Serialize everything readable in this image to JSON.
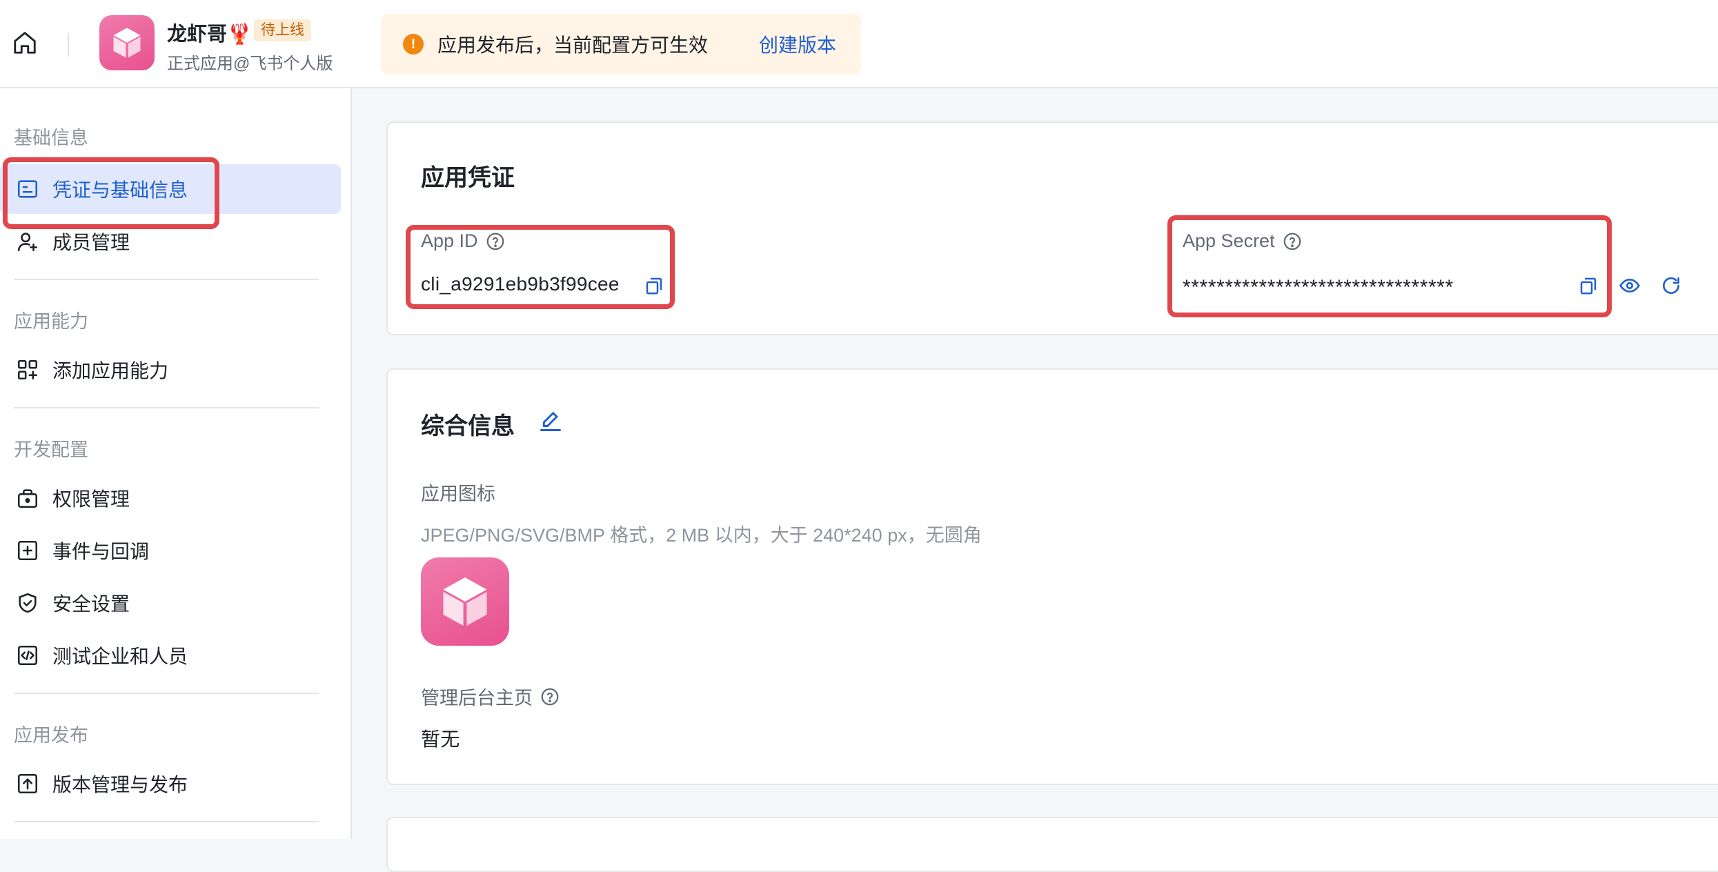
{
  "topbar": {
    "app_name": "龙虾哥🦞",
    "status_badge": "待上线",
    "app_subtitle": "正式应用@飞书个人版",
    "notice_text": "应用发布后，当前配置方可生效",
    "notice_link": "创建版本"
  },
  "sidebar": {
    "groups": [
      {
        "title": "基础信息",
        "items": [
          {
            "label": "凭证与基础信息",
            "icon": "id-card-icon"
          },
          {
            "label": "成员管理",
            "icon": "user-add-icon"
          }
        ]
      },
      {
        "title": "应用能力",
        "items": [
          {
            "label": "添加应用能力",
            "icon": "grid-add-icon"
          }
        ]
      },
      {
        "title": "开发配置",
        "items": [
          {
            "label": "权限管理",
            "icon": "permission-lock-icon"
          },
          {
            "label": "事件与回调",
            "icon": "event-plus-icon"
          },
          {
            "label": "安全设置",
            "icon": "shield-check-icon"
          },
          {
            "label": "测试企业和人员",
            "icon": "code-icon"
          }
        ]
      },
      {
        "title": "应用发布",
        "items": [
          {
            "label": "版本管理与发布",
            "icon": "upload-icon"
          }
        ]
      }
    ],
    "active_item": "凭证与基础信息"
  },
  "credentials": {
    "title": "应用凭证",
    "app_id_label": "App ID",
    "app_id_value": "cli_a9291eb9b3f99cee",
    "app_secret_label": "App Secret",
    "app_secret_value": "********************************"
  },
  "info": {
    "title": "综合信息",
    "icon_label": "应用图标",
    "icon_hint": "JPEG/PNG/SVG/BMP 格式，2 MB 以内，大于 240*240 px，无圆角",
    "admin_home_label": "管理后台主页",
    "admin_home_value": "暂无"
  },
  "colors": {
    "accent": "#1f5fd0",
    "highlight_box": "#e0474c",
    "active_bg": "#e1e8fd",
    "logo_pink": "#e8518f"
  }
}
